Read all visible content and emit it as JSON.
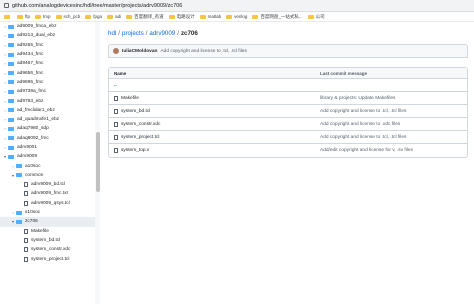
{
  "browser": {
    "url": "github.com/analogdevicesinc/hdl/tree/master/projects/adrv9009/zc706",
    "bookmarks": [
      "",
      "ftp",
      "tmp",
      "sch_pcb",
      "fpga",
      "adi",
      "百度翻译_有道",
      "电路设计",
      "matlab",
      "verilog",
      "百度网盘_一站式私...",
      "公司"
    ]
  },
  "sidebar": {
    "items": [
      {
        "label": "ad9009_fmca_ebz",
        "type": "folder",
        "expanded": false
      },
      {
        "label": "ad9213_dual_ebz",
        "type": "folder",
        "expanded": false
      },
      {
        "label": "ad9265_fmc",
        "type": "folder",
        "expanded": false
      },
      {
        "label": "ad9434_fmc",
        "type": "folder",
        "expanded": false
      },
      {
        "label": "ad9467_fmc",
        "type": "folder",
        "expanded": false
      },
      {
        "label": "ad9656_fmc",
        "type": "folder",
        "expanded": false
      },
      {
        "label": "ad9695_fmc",
        "type": "folder",
        "expanded": false
      },
      {
        "label": "ad9739a_fmc",
        "type": "folder",
        "expanded": false
      },
      {
        "label": "ad9783_ebz",
        "type": "folder",
        "expanded": false
      },
      {
        "label": "ad_fmclidar1_ebz",
        "type": "folder",
        "expanded": false
      },
      {
        "label": "ad_quadmxfe1_ebz",
        "type": "folder",
        "expanded": false
      },
      {
        "label": "adaq7980_sdp",
        "type": "folder",
        "expanded": false
      },
      {
        "label": "adaq8092_fmc",
        "type": "folder",
        "expanded": false
      },
      {
        "label": "adrv9001",
        "type": "folder",
        "expanded": false
      },
      {
        "label": "adrv9009",
        "type": "folder",
        "expanded": true
      },
      {
        "label": "a10soc",
        "type": "folder",
        "expanded": false,
        "indent": 1
      },
      {
        "label": "common",
        "type": "folder",
        "expanded": true,
        "indent": 1
      },
      {
        "label": "adrv9009_bd.tcl",
        "type": "file",
        "indent": 2
      },
      {
        "label": "adrv9009_fmc.txt",
        "type": "file",
        "indent": 2
      },
      {
        "label": "adrv9009_qsys.tcl",
        "type": "file",
        "indent": 2
      },
      {
        "label": "s10soc",
        "type": "folder",
        "expanded": false,
        "indent": 1
      },
      {
        "label": "zc706",
        "type": "folder",
        "expanded": true,
        "indent": 1,
        "active": true
      },
      {
        "label": "Makefile",
        "type": "file",
        "indent": 2
      },
      {
        "label": "system_bd.tcl",
        "type": "file",
        "indent": 2
      },
      {
        "label": "system_constr.xdc",
        "type": "file",
        "indent": 2
      },
      {
        "label": "system_project.tcl",
        "type": "file",
        "indent": 2
      }
    ]
  },
  "breadcrumb": {
    "parts": [
      "hdl",
      "projects",
      "adrv9009"
    ],
    "current": "zc706",
    "sep": "/"
  },
  "commit": {
    "author": "IuliaCMoldovan",
    "message": "Add copyright and license to .tcl, .tcl files"
  },
  "table": {
    "headers": {
      "name": "Name",
      "message": "Last commit message"
    },
    "rows": [
      {
        "name": "..",
        "message": "",
        "type": "up"
      },
      {
        "name": "Makefile",
        "message": "library & projects: Update Makefiles",
        "type": "file"
      },
      {
        "name": "system_bd.tcl",
        "message": "Add copyright and license to .tcl, .tcl files",
        "type": "file"
      },
      {
        "name": "system_constr.xdc",
        "message": "Add copyright and license to .xdc files",
        "type": "file"
      },
      {
        "name": "system_project.tcl",
        "message": "Add copyright and license to .tcl, .tcl files",
        "type": "file"
      },
      {
        "name": "system_top.v",
        "message": "Add/edit copyright and license for v, .sv files",
        "type": "file"
      }
    ]
  },
  "colors": {
    "link": "#0969da",
    "folder": "#54aeff",
    "border": "#d0d7de"
  }
}
